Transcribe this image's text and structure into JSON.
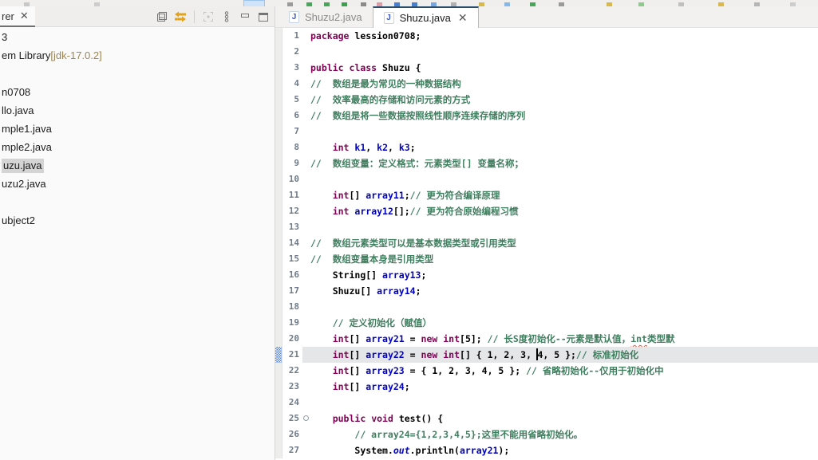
{
  "explorer": {
    "tab_label": "rer",
    "toolbar": [
      {
        "name": "collapse-all"
      },
      {
        "name": "link-with-editor"
      },
      {
        "name": "focus"
      },
      {
        "name": "view-menu"
      },
      {
        "name": "minimize"
      },
      {
        "name": "maximize"
      }
    ],
    "items": [
      {
        "label": "3"
      },
      {
        "label": "em Library ",
        "decoration": "[jdk-17.0.2]"
      },
      {
        "label": ""
      },
      {
        "label": "n0708"
      },
      {
        "label": "llo.java"
      },
      {
        "label": "mple1.java"
      },
      {
        "label": "mple2.java"
      },
      {
        "label": "uzu.java",
        "selected": true
      },
      {
        "label": "uzu2.java"
      },
      {
        "label": ""
      },
      {
        "label": "ubject2"
      }
    ]
  },
  "editor": {
    "tabs": [
      {
        "label": "Shuzu2.java",
        "active": false,
        "closable": false
      },
      {
        "label": "Shuzu.java",
        "active": true,
        "closable": true
      }
    ],
    "lines": [
      {
        "n": 1,
        "t": [
          [
            "k",
            "package"
          ],
          [
            "p",
            " lession0708;"
          ]
        ]
      },
      {
        "n": 2,
        "t": []
      },
      {
        "n": 3,
        "t": [
          [
            "k",
            "public"
          ],
          [
            "p",
            " "
          ],
          [
            "k",
            "class"
          ],
          [
            "p",
            " Shuzu {"
          ]
        ]
      },
      {
        "n": 4,
        "t": [
          [
            "c",
            "//\t数组是最为常见的一种数据结构"
          ]
        ]
      },
      {
        "n": 5,
        "t": [
          [
            "c",
            "//\t效率最高的存储和访问元素的方式"
          ]
        ]
      },
      {
        "n": 6,
        "t": [
          [
            "c",
            "//\t数组是将一些数据按照线性顺序连续存储的序列"
          ]
        ]
      },
      {
        "n": 7,
        "t": []
      },
      {
        "n": 8,
        "t": [
          [
            "p",
            "\t"
          ],
          [
            "k",
            "int"
          ],
          [
            "p",
            " "
          ],
          [
            "f",
            "k1"
          ],
          [
            "p",
            ", "
          ],
          [
            "f",
            "k2"
          ],
          [
            "p",
            ", "
          ],
          [
            "f",
            "k3"
          ],
          [
            "p",
            ";"
          ]
        ]
      },
      {
        "n": 9,
        "t": [
          [
            "c",
            "//\t数组变量：定义格式：元素类型[] 变量名称；"
          ]
        ]
      },
      {
        "n": 10,
        "t": []
      },
      {
        "n": 11,
        "t": [
          [
            "p",
            "\t"
          ],
          [
            "k",
            "int"
          ],
          [
            "p",
            "[] "
          ],
          [
            "f",
            "array11"
          ],
          [
            "p",
            ";"
          ],
          [
            "c",
            "// 更为符合编译原理"
          ]
        ]
      },
      {
        "n": 12,
        "t": [
          [
            "p",
            "\t"
          ],
          [
            "k",
            "int"
          ],
          [
            "p",
            " "
          ],
          [
            "f",
            "array12"
          ],
          [
            "p",
            "[];"
          ],
          [
            "c",
            "// 更为符合原始编程习惯"
          ]
        ]
      },
      {
        "n": 13,
        "t": []
      },
      {
        "n": 14,
        "t": [
          [
            "c",
            "//\t数组元素类型可以是基本数据类型或引用类型"
          ]
        ]
      },
      {
        "n": 15,
        "t": [
          [
            "c",
            "//\t数组变量本身是引用类型"
          ]
        ]
      },
      {
        "n": 16,
        "t": [
          [
            "p",
            "\tString[] "
          ],
          [
            "f",
            "array13"
          ],
          [
            "p",
            ";"
          ]
        ]
      },
      {
        "n": 17,
        "t": [
          [
            "p",
            "\tShuzu[] "
          ],
          [
            "f",
            "array14"
          ],
          [
            "p",
            ";"
          ]
        ]
      },
      {
        "n": 18,
        "t": []
      },
      {
        "n": 19,
        "t": [
          [
            "p",
            "\t"
          ],
          [
            "c",
            "// 定义初始化（赋值）"
          ]
        ]
      },
      {
        "n": 20,
        "t": [
          [
            "p",
            "\t"
          ],
          [
            "k",
            "int"
          ],
          [
            "p",
            "[] "
          ],
          [
            "f",
            "array21"
          ],
          [
            "p",
            " = "
          ],
          [
            "k",
            "new"
          ],
          [
            "p",
            " "
          ],
          [
            "k",
            "int"
          ],
          [
            "p",
            "[5]; "
          ],
          [
            "c",
            "// 长S度初始化--元素是默认值，"
          ],
          [
            "cr",
            "int"
          ],
          [
            "c",
            "类型默"
          ]
        ]
      },
      {
        "n": 21,
        "cur": true,
        "marker": true,
        "t": [
          [
            "p",
            "\t"
          ],
          [
            "k",
            "int"
          ],
          [
            "p",
            "[] "
          ],
          [
            "f",
            "array22"
          ],
          [
            "p",
            " = "
          ],
          [
            "k",
            "new"
          ],
          [
            "p",
            " "
          ],
          [
            "k",
            "int"
          ],
          [
            "p",
            "[] { 1, 2, 3, "
          ],
          [
            "caret",
            ""
          ],
          [
            "p",
            "4, 5 };"
          ],
          [
            "c",
            "// 标准初始化"
          ]
        ]
      },
      {
        "n": 22,
        "t": [
          [
            "p",
            "\t"
          ],
          [
            "k",
            "int"
          ],
          [
            "p",
            "[] "
          ],
          [
            "f",
            "array23"
          ],
          [
            "p",
            " = { 1, 2, 3, 4, 5 }; "
          ],
          [
            "c",
            "// 省略初始化--仅用于初始化中"
          ]
        ]
      },
      {
        "n": 23,
        "t": [
          [
            "p",
            "\t"
          ],
          [
            "k",
            "int"
          ],
          [
            "p",
            "[] "
          ],
          [
            "f",
            "array24"
          ],
          [
            "p",
            ";"
          ]
        ]
      },
      {
        "n": 24,
        "t": []
      },
      {
        "n": 25,
        "fold": true,
        "t": [
          [
            "p",
            "\t"
          ],
          [
            "k",
            "public"
          ],
          [
            "p",
            " "
          ],
          [
            "k",
            "void"
          ],
          [
            "p",
            " test() {"
          ]
        ]
      },
      {
        "n": 26,
        "t": [
          [
            "p",
            "\t\t"
          ],
          [
            "c",
            "// array24={1,2,3,4,5};这里不能用省略初始化。"
          ]
        ]
      },
      {
        "n": 27,
        "t": [
          [
            "p",
            "\t\tSystem."
          ],
          [
            "s",
            "out"
          ],
          [
            "p",
            ".println("
          ],
          [
            "f",
            "array21"
          ],
          [
            "p",
            ");"
          ]
        ]
      }
    ]
  },
  "colors": {
    "keyword": "#7f0055",
    "comment": "#3f7f5f",
    "field": "#0000c0",
    "active_tab_border": "#2a4d6e",
    "selection_bg": "#d4d4d4",
    "current_line_bg": "#e4e6e7",
    "link_icon": "#e2a41c",
    "error_squiggle": "#e8553f"
  }
}
